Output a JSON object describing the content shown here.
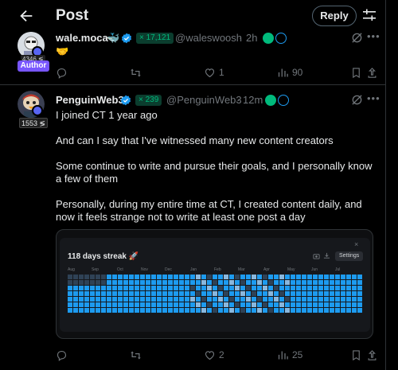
{
  "header": {
    "title": "Post",
    "reply_label": "Reply"
  },
  "post1": {
    "display_name": "wale.moca",
    "name_emoji": "🐳",
    "subscribers": "× 17,121",
    "handle": "@waleswoosh",
    "separator": "·",
    "time": "2h",
    "author_tag": "Author",
    "avatar_tag": "4346 ≶",
    "content": "🤝",
    "reply_count": "",
    "repost_count": "",
    "like_count": "1",
    "view_count": "90"
  },
  "post2": {
    "display_name": "PenguinWeb3",
    "subscribers": "× 239",
    "handle": "@PenguinWeb3",
    "separator": "·",
    "time": "12m",
    "avatar_tag": "1553 ≶",
    "paragraphs": [
      "I joined CT 1 year ago",
      "And can I say that I've witnessed many new content creators",
      "Some continue to write and pursue their goals, and I personally know a few of them",
      "Personally, during my entire time at CT, I created content daily, and now it feels strange not to write at least one post a day"
    ],
    "reply_count": "",
    "repost_count": "",
    "like_count": "2",
    "view_count": "25"
  },
  "card": {
    "title": "118 days streak 🚀",
    "settings_label": "Settings",
    "close_symbol": "×",
    "months": [
      "Aug",
      "Sep",
      "Oct",
      "Nov",
      "Dec",
      "Jan",
      "Feb",
      "Mar",
      "Apr",
      "May",
      "Jun",
      "Jul"
    ]
  },
  "colors": {
    "accent": "#1d9bf0",
    "verified": "#1d9bf0",
    "author_tag": "#7856ff",
    "subscriber_green": "#00ba7c",
    "grid_active": "#1d9bf0",
    "grid_light": "#8ab8de",
    "grid_inactive": "#2f4256"
  }
}
